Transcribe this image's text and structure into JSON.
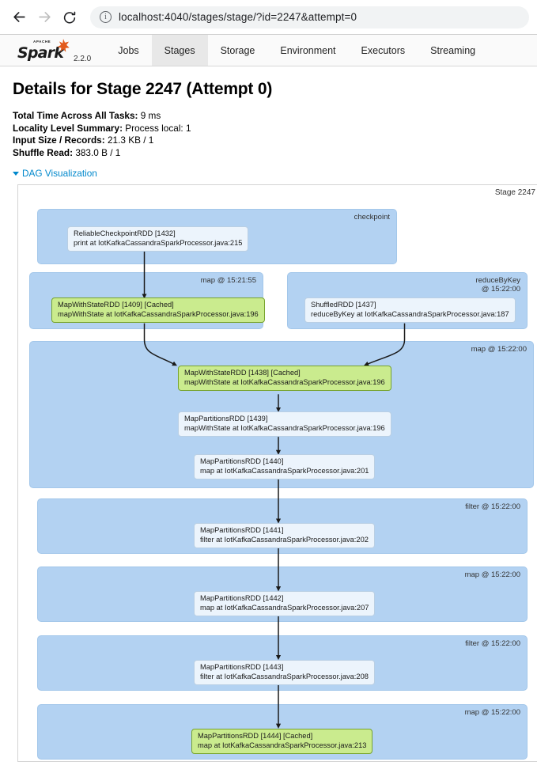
{
  "browser": {
    "back_icon": "back-arrow-icon",
    "forward_icon": "forward-arrow-icon",
    "reload_icon": "reload-icon",
    "info_icon": "info-circle-icon",
    "info_glyph": "i",
    "url": "localhost:4040/stages/stage/?id=2247&attempt=0"
  },
  "navbar": {
    "brand_word": "Spark",
    "brand_apache": "APACHE",
    "version": "2.2.0",
    "tabs": [
      {
        "label": "Jobs",
        "active": false
      },
      {
        "label": "Stages",
        "active": true
      },
      {
        "label": "Storage",
        "active": false
      },
      {
        "label": "Environment",
        "active": false
      },
      {
        "label": "Executors",
        "active": false
      },
      {
        "label": "Streaming",
        "active": false
      }
    ]
  },
  "page": {
    "title": "Details for Stage 2247 (Attempt 0)",
    "summary": [
      {
        "label": "Total Time Across All Tasks:",
        "value": "9 ms"
      },
      {
        "label": "Locality Level Summary:",
        "value": "Process local: 1"
      },
      {
        "label": "Input Size / Records:",
        "value": "21.3 KB / 1"
      },
      {
        "label": "Shuffle Read:",
        "value": "383.0 B / 1"
      }
    ],
    "dag_toggle_label": "DAG Visualization"
  },
  "dag": {
    "stage_label": "Stage 2247",
    "clusters": [
      {
        "id": "checkpoint",
        "label": "checkpoint"
      },
      {
        "id": "map1521",
        "label": "map @ 15:21:55"
      },
      {
        "id": "reduceByKey",
        "label": "reduceByKey\n@ 15:22:00"
      },
      {
        "id": "map1522a",
        "label": "map @ 15:22:00"
      },
      {
        "id": "filter1522a",
        "label": "filter @ 15:22:00"
      },
      {
        "id": "map1522b",
        "label": "map @ 15:22:00"
      },
      {
        "id": "filter1522b",
        "label": "filter @ 15:22:00"
      },
      {
        "id": "map1522c",
        "label": "map @ 15:22:00"
      }
    ],
    "nodes": [
      {
        "id": "n1432",
        "line1": "ReliableCheckpointRDD [1432]",
        "line2": "print at IotKafkaCassandraSparkProcessor.java:215",
        "cached": false
      },
      {
        "id": "n1409",
        "line1": "MapWithStateRDD [1409] [Cached]",
        "line2": "mapWithState at IotKafkaCassandraSparkProcessor.java:196",
        "cached": true
      },
      {
        "id": "n1437",
        "line1": "ShuffledRDD [1437]",
        "line2": "reduceByKey at IotKafkaCassandraSparkProcessor.java:187",
        "cached": false
      },
      {
        "id": "n1438",
        "line1": "MapWithStateRDD [1438] [Cached]",
        "line2": "mapWithState at IotKafkaCassandraSparkProcessor.java:196",
        "cached": true
      },
      {
        "id": "n1439",
        "line1": "MapPartitionsRDD [1439]",
        "line2": "mapWithState at IotKafkaCassandraSparkProcessor.java:196",
        "cached": false
      },
      {
        "id": "n1440",
        "line1": "MapPartitionsRDD [1440]",
        "line2": "map at IotKafkaCassandraSparkProcessor.java:201",
        "cached": false
      },
      {
        "id": "n1441",
        "line1": "MapPartitionsRDD [1441]",
        "line2": "filter at IotKafkaCassandraSparkProcessor.java:202",
        "cached": false
      },
      {
        "id": "n1442",
        "line1": "MapPartitionsRDD [1442]",
        "line2": "map at IotKafkaCassandraSparkProcessor.java:207",
        "cached": false
      },
      {
        "id": "n1443",
        "line1": "MapPartitionsRDD [1443]",
        "line2": "filter at IotKafkaCassandraSparkProcessor.java:208",
        "cached": false
      },
      {
        "id": "n1444",
        "line1": "MapPartitionsRDD [1444] [Cached]",
        "line2": "map at IotKafkaCassandraSparkProcessor.java:213",
        "cached": true
      }
    ]
  },
  "colors": {
    "cluster_fill": "#b3d2f2",
    "node_fill": "#ecf4fc",
    "cached_fill": "#caeb8e",
    "cached_stroke": "#77a32d",
    "link": "#0088cc",
    "spark_orange": "#e25a1c"
  }
}
